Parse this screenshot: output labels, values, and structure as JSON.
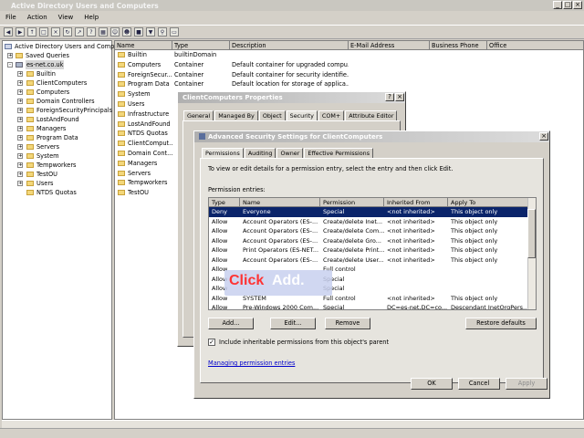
{
  "app": {
    "title": "Active Directory Users and Computers",
    "menu": [
      "File",
      "Action",
      "View",
      "Help"
    ],
    "window_buttons": [
      "_",
      "□",
      "×"
    ]
  },
  "toolbar": {
    "icons": [
      "back-icon",
      "forward-icon",
      "up-icon",
      "properties-icon",
      "delete-icon",
      "refresh-icon",
      "export-icon",
      "help-icon",
      "console-icon",
      "add-user-icon",
      "add-group-icon",
      "add-ou-icon",
      "filter-icon",
      "find-icon",
      "folder-icon"
    ]
  },
  "tree": {
    "root": "Active Directory Users and Comput",
    "saved_queries": "Saved Queries",
    "domain": "es-net.co.uk",
    "items": [
      "Builtin",
      "ClientComputers",
      "Computers",
      "Domain Controllers",
      "ForeignSecurityPrincipals",
      "LostAndFound",
      "Managers",
      "Program Data",
      "Servers",
      "System",
      "Tempworkers",
      "TestOU",
      "Users",
      "NTDS Quotas"
    ]
  },
  "list": {
    "headers": [
      "Name",
      "Type",
      "Description",
      "E-Mail Address",
      "Business Phone",
      "Office"
    ],
    "rows": [
      [
        "Builtin",
        "builtinDomain",
        ""
      ],
      [
        "Computers",
        "Container",
        "Default container for upgraded compu..."
      ],
      [
        "ForeignSecur...",
        "Container",
        "Default container for security identifie..."
      ],
      [
        "Program Data",
        "Container",
        "Default location for storage of applica..."
      ],
      [
        "System",
        "",
        ""
      ],
      [
        "Users",
        "",
        ""
      ],
      [
        "Infrastructure",
        "",
        ""
      ],
      [
        "LostAndFound",
        "",
        ""
      ],
      [
        "NTDS Quotas",
        "",
        ""
      ],
      [
        "ClientComput...",
        "",
        ""
      ],
      [
        "Domain Cont...",
        "",
        ""
      ],
      [
        "Managers",
        "",
        ""
      ],
      [
        "Servers",
        "",
        ""
      ],
      [
        "Tempworkers",
        "",
        ""
      ],
      [
        "TestOU",
        "",
        ""
      ]
    ]
  },
  "props_dialog": {
    "title": "ClientComputers Properties",
    "tabs": [
      "General",
      "Managed By",
      "Object",
      "Security",
      "COM+",
      "Attribute Editor"
    ],
    "selected_tab": "Security"
  },
  "adv_dialog": {
    "title": "Advanced Security Settings for ClientComputers",
    "tabs": [
      "Permissions",
      "Auditing",
      "Owner",
      "Effective Permissions"
    ],
    "instruction": "To view or edit details for a permission entry, select the entry and then click Edit.",
    "entries_label": "Permission entries:",
    "columns": [
      "Type",
      "Name",
      "Permission",
      "Inherited From",
      "Apply To"
    ],
    "entries": [
      [
        "Deny",
        "Everyone",
        "Special",
        "<not inherited>",
        "This object only"
      ],
      [
        "Allow",
        "Account Operators (ES-...",
        "Create/delete Inet...",
        "<not inherited>",
        "This object only"
      ],
      [
        "Allow",
        "Account Operators (ES-...",
        "Create/delete Com...",
        "<not inherited>",
        "This object only"
      ],
      [
        "Allow",
        "Account Operators (ES-...",
        "Create/delete Gro...",
        "<not inherited>",
        "This object only"
      ],
      [
        "Allow",
        "Print Operators (ES-NET...",
        "Create/delete Print...",
        "<not inherited>",
        "This object only"
      ],
      [
        "Allow",
        "Account Operators (ES-...",
        "Create/delete User...",
        "<not inherited>",
        "This object only"
      ],
      [
        "Allow",
        "",
        "Full control",
        "",
        ""
      ],
      [
        "Allow",
        "",
        "Special",
        "",
        ""
      ],
      [
        "Allow",
        "",
        "Special",
        "",
        ""
      ],
      [
        "Allow",
        "SYSTEM",
        "Full control",
        "<not inherited>",
        "This object only"
      ],
      [
        "Allow",
        "Pre-Windows 2000 Com...",
        "Special",
        "DC=es-net,DC=co...",
        "Descendant InetOrgPers..."
      ]
    ],
    "add_label": "Add...",
    "edit_label": "Edit...",
    "remove_label": "Remove",
    "restore_label": "Restore defaults",
    "inherit_label": "Include inheritable permissions from this object's parent",
    "inherit_checked": true,
    "link_label": "Managing permission entries",
    "ok_label": "OK",
    "cancel_label": "Cancel",
    "apply_label": "Apply"
  },
  "callout": {
    "prefix": "Click",
    "emphasis": "Add.",
    "prefix_color": "#ff3333",
    "emphasis_color": "#ffffff"
  },
  "colors": {
    "selection": "#0a246a",
    "link": "#0000cc"
  }
}
